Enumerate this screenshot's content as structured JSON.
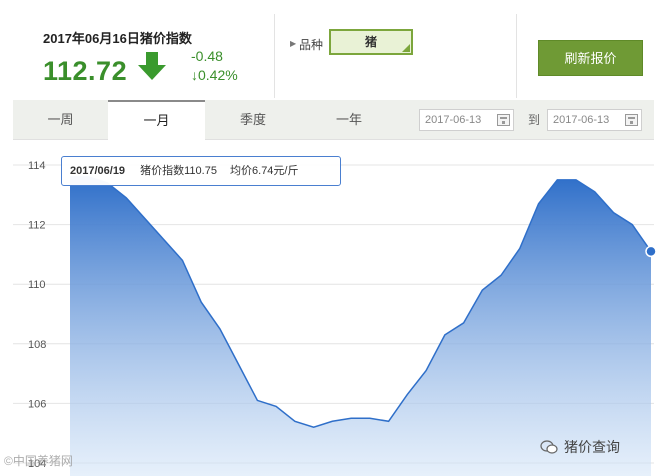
{
  "header": {
    "title": "2017年06月16日猪价指数",
    "value": "112.72",
    "change": "-0.48",
    "change_pct": "↓0.42%",
    "trend": "down-arrow-icon"
  },
  "variety": {
    "label": "品种",
    "selected": "猪"
  },
  "refresh_label": "刷新报价",
  "tabs": [
    {
      "label": "一周"
    },
    {
      "label": "一月"
    },
    {
      "label": "季度"
    },
    {
      "label": "一年"
    }
  ],
  "active_tab": "一月",
  "date_range": {
    "from": "2017-06-13",
    "to_label": "到",
    "to": "2017-06-13"
  },
  "tooltip": {
    "date": "2017/06/19",
    "index": "猪价指数110.75",
    "avg": "均价6.74元/斤"
  },
  "watermarks": {
    "left": "©中国养猪网",
    "right": "猪价查询"
  },
  "colors": {
    "accent": "#6f9a35",
    "up_down": "#3a8f2b",
    "line": "#2f6fc9",
    "fill_top": "#2f6fc9",
    "fill_bottom": "#d6e6f8"
  },
  "chart_data": {
    "type": "area",
    "ylim": [
      104,
      114
    ],
    "yticks": [
      "114",
      "112",
      "110",
      "108",
      "106",
      "104"
    ],
    "grid": true,
    "values": [
      113.6,
      113.6,
      113.4,
      112.9,
      112.2,
      111.5,
      110.8,
      109.4,
      108.5,
      107.3,
      106.1,
      105.9,
      105.4,
      105.2,
      105.4,
      105.5,
      105.5,
      105.4,
      106.3,
      107.1,
      108.3,
      108.7,
      109.8,
      110.3,
      111.2,
      112.7,
      113.5,
      113.5,
      113.1,
      112.4,
      112.0,
      111.1
    ]
  }
}
